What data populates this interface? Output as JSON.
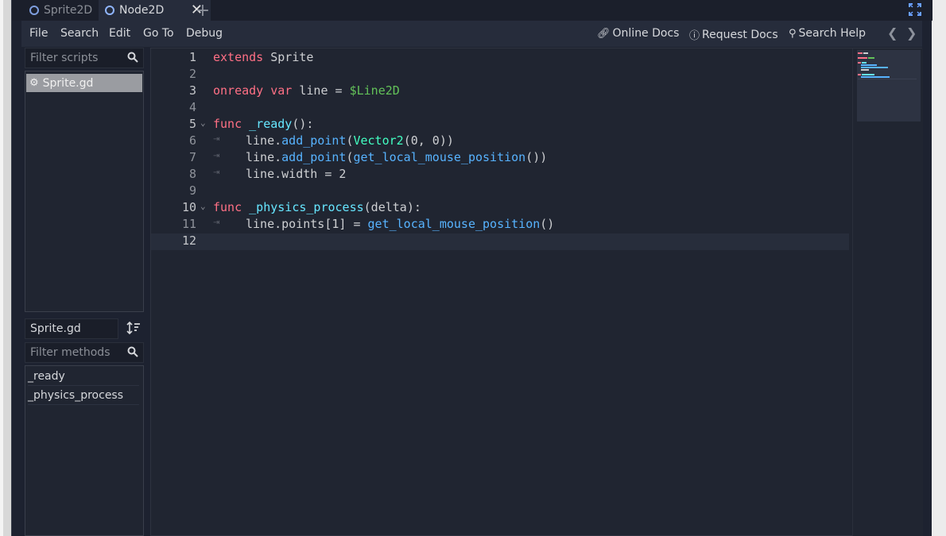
{
  "tabs": [
    {
      "label": "Sprite2D",
      "active": false
    },
    {
      "label": "Node2D",
      "active": true
    }
  ],
  "menu": {
    "left": [
      "File",
      "Search",
      "Edit",
      "Go To",
      "Debug"
    ],
    "right": [
      "Online Docs",
      "Request Docs",
      "Search Help"
    ]
  },
  "scripts": {
    "filter_placeholder": "Filter scripts",
    "items": [
      {
        "label": "Sprite.gd",
        "selected": true
      }
    ],
    "current": "Sprite.gd"
  },
  "methods": {
    "filter_placeholder": "Filter methods",
    "items": [
      "_ready",
      "_physics_process"
    ]
  },
  "editor": {
    "current_line": 12,
    "lines": [
      {
        "n": "1",
        "text": "extends Sprite"
      },
      {
        "n": "2",
        "text": ""
      },
      {
        "n": "3",
        "text": "onready var line = $Line2D"
      },
      {
        "n": "4",
        "text": ""
      },
      {
        "n": "5",
        "text": "func _ready():"
      },
      {
        "n": "6",
        "text": "line.add_point(Vector2(0, 0))"
      },
      {
        "n": "7",
        "text": "line.add_point(get_local_mouse_position())"
      },
      {
        "n": "8",
        "text": "line.width = 2"
      },
      {
        "n": "9",
        "text": ""
      },
      {
        "n": "10",
        "text": "func _physics_process(delta):"
      },
      {
        "n": "11",
        "text": "line.points[1] = get_local_mouse_position()"
      },
      {
        "n": "12",
        "text": ""
      }
    ]
  },
  "colors": {
    "keyword": "#ff7085",
    "function": "#57b3ff",
    "type": "#42ffc2",
    "node_path": "#63c259",
    "background": "#202531"
  }
}
